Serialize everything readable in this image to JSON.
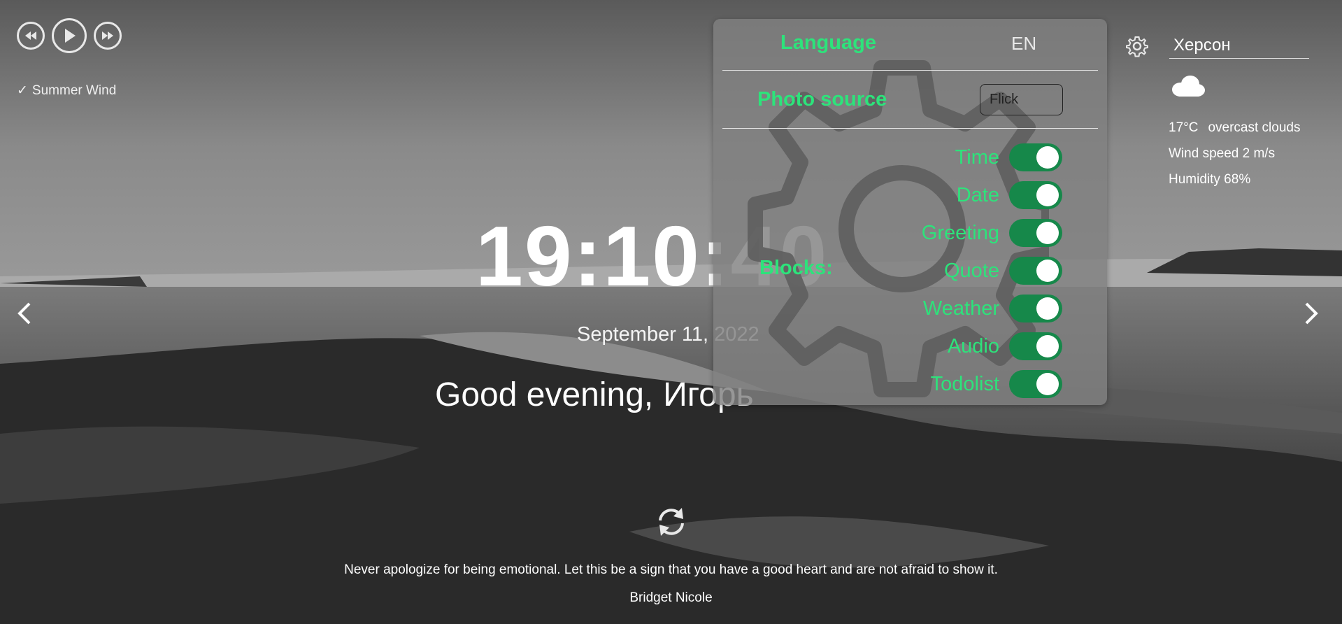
{
  "player": {
    "prev_icon": "rewind-icon",
    "play_icon": "play-icon",
    "next_icon": "fast-forward-icon",
    "track_check": "✓",
    "track": "Summer Wind"
  },
  "clock": {
    "time": "19:10:40",
    "date": "September 11, 2022",
    "greeting": "Good evening,",
    "name": "Игорь"
  },
  "quote": {
    "text": "Never apologize for being emotional. Let this be a sign that you have a good heart and are not afraid to show it.",
    "author": "Bridget Nicole"
  },
  "weather": {
    "city": "Херсон",
    "temperature": "17°C",
    "description": "overcast clouds",
    "wind": "Wind speed 2 m/s",
    "humidity": "Humidity 68%",
    "icon": "cloud-icon"
  },
  "settings": {
    "language_label": "Language",
    "language_value": "EN",
    "photo_source_label": "Photo source",
    "photo_source_value": "Flick",
    "blocks_label": "Blocks:",
    "toggles": [
      {
        "label": "Time",
        "on": true
      },
      {
        "label": "Date",
        "on": true
      },
      {
        "label": "Greeting",
        "on": true
      },
      {
        "label": "Quote",
        "on": true
      },
      {
        "label": "Weather",
        "on": true
      },
      {
        "label": "Audio",
        "on": true
      },
      {
        "label": "Todolist",
        "on": true
      }
    ]
  },
  "colors": {
    "accent": "#2de37b",
    "toggle_on": "#16884a"
  }
}
